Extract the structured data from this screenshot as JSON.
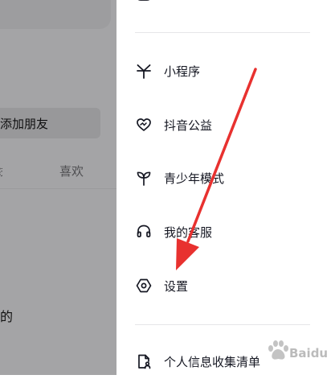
{
  "left_panel": {
    "add_friend_label": "添加朋友",
    "tab_partial": "线",
    "tab_like": "喜欢",
    "bottom_text": "的"
  },
  "menu": {
    "items": [
      {
        "label": "小程序",
        "icon": "mini-program-icon"
      },
      {
        "label": "抖音公益",
        "icon": "charity-icon"
      },
      {
        "label": "青少年模式",
        "icon": "teen-mode-icon"
      },
      {
        "label": "我的客服",
        "icon": "customer-service-icon"
      },
      {
        "label": "设置",
        "icon": "settings-icon"
      },
      {
        "label": "个人信息收集清单",
        "icon": "personal-info-list-icon"
      }
    ]
  },
  "colors": {
    "overlay": "#a4a4a6",
    "arrow": "#e8312f",
    "text": "#161823"
  },
  "watermark": {
    "text": "Baidu 经验"
  }
}
